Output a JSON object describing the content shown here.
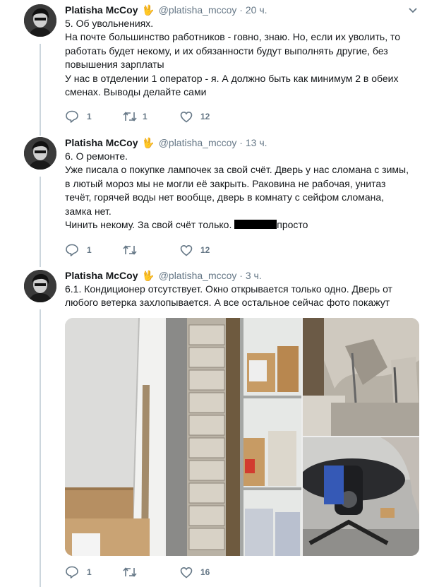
{
  "icons": {
    "reply": "speech-bubble-icon",
    "retweet": "retweet-arrows-icon",
    "like": "heart-icon",
    "more": "chevron-down-icon",
    "emoji": "vulcan-salute-emoji"
  },
  "colors": {
    "text": "#14171a",
    "secondary": "#657786",
    "thread": "#ccd6dd"
  },
  "tweets": [
    {
      "name": "Platisha McCoy",
      "emoji": "🖖",
      "handle": "@platisha_mccoy",
      "dot": "·",
      "time": "20 ч.",
      "lines": [
        "5. Об увольнениях.",
        "На почте большинство работников - говно, знаю. Но, если их уволить, то",
        "работать будет некому, и их обязанности будут выполнять другие, без",
        "повышения зарплаты",
        "У нас в отделении 1 оператор - я. А должно быть как минимум 2 в обеих",
        "сменах. Выводы делайте сами"
      ],
      "replies": "1",
      "retweets": "1",
      "likes": "12"
    },
    {
      "name": "Platisha McCoy",
      "emoji": "🖖",
      "handle": "@platisha_mccoy",
      "dot": "·",
      "time": "13 ч.",
      "lines": [
        "6. О ремонте.",
        "Уже писала о покупке лампочек за свой счёт. Дверь у нас сломана с зимы,",
        "в лютый мороз мы не могли её закрыть. Раковина не рабочая, унитаз",
        "течёт, горячей воды нет вообще, дверь в комнату с сейфом сломана,",
        "замка нет."
      ],
      "last_line_before": "Чинить некому. За свой счёт только. ",
      "last_line_after": "просто",
      "replies": "1",
      "retweets": "",
      "likes": "12"
    },
    {
      "name": "Platisha McCoy",
      "emoji": "🖖",
      "handle": "@platisha_mccoy",
      "dot": "·",
      "time": "3 ч.",
      "lines": [
        "6.1. Кондиционер отсутствует. Окно открывается только одно. Дверь от",
        "любого ветерка захлопывается. А все остальное сейчас фото покажут"
      ],
      "replies": "1",
      "retweets": "",
      "likes": "16"
    }
  ]
}
